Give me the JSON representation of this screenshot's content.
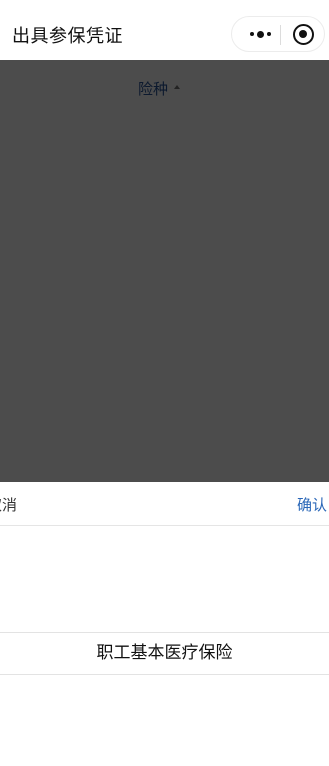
{
  "navbar": {
    "title": "出具参保凭证",
    "more_icon": "more-dots-icon",
    "close_icon": "mini-program-close-icon"
  },
  "filter": {
    "label": "险种",
    "caret_icon": "caret-up-icon"
  },
  "picker": {
    "cancel_label": "取消",
    "confirm_label": "确认",
    "options": [
      "职工基本医疗保险"
    ],
    "selected": "职工基本医疗保险"
  },
  "colors": {
    "accent": "#2a67b8",
    "mask": "rgba(0,0,0,0.7)"
  }
}
